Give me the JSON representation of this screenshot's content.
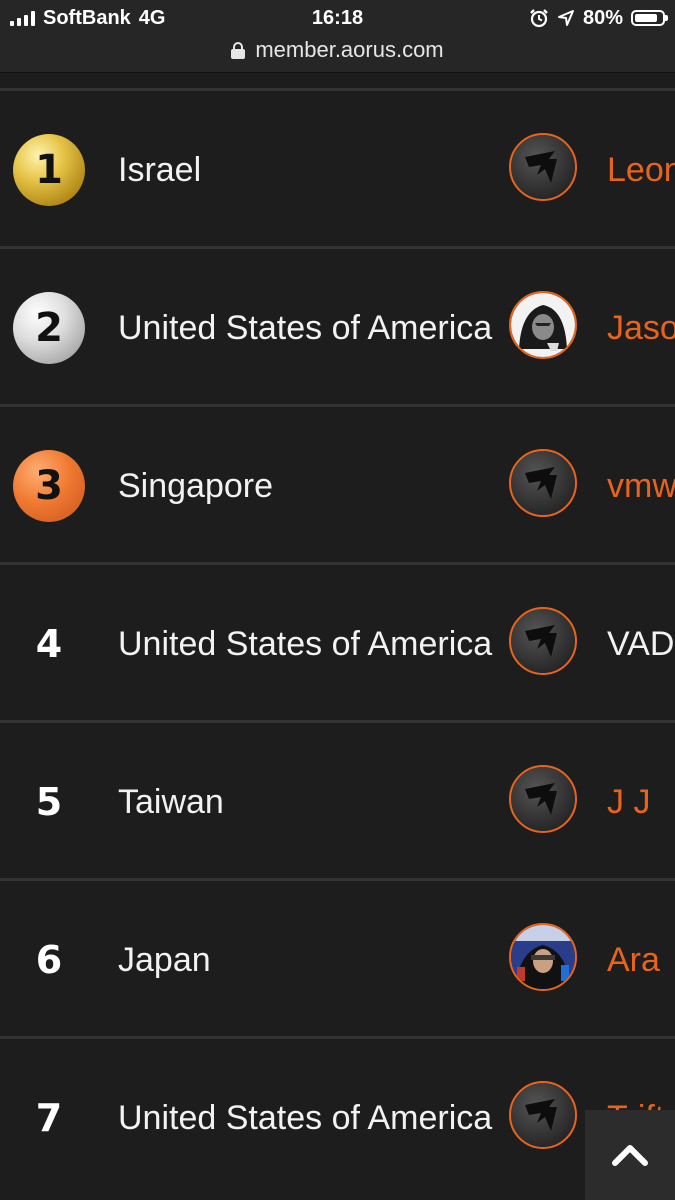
{
  "status_bar": {
    "carrier": "SoftBank",
    "network": "4G",
    "time": "16:18",
    "battery": "80%"
  },
  "browser": {
    "url": "member.aorus.com"
  },
  "colors": {
    "accent": "#e8641c",
    "background": "#1d1d1d"
  },
  "rankings": [
    {
      "rank": "1",
      "country": "Israel",
      "user": "Leon",
      "avatar": "aorus-logo-avatar",
      "medal": "gold"
    },
    {
      "rank": "2",
      "country": "United States of America",
      "user": "Jaso",
      "avatar": "hooded-person-avatar",
      "medal": "silver"
    },
    {
      "rank": "3",
      "country": "Singapore",
      "user": "vmw",
      "avatar": "aorus-logo-avatar",
      "medal": "bronze"
    },
    {
      "rank": "4",
      "country": "United States of America",
      "user": "VAD",
      "avatar": "aorus-logo-avatar",
      "medal": "none"
    },
    {
      "rank": "5",
      "country": "Taiwan",
      "user": "J J",
      "avatar": "aorus-logo-avatar",
      "medal": "none"
    },
    {
      "rank": "6",
      "country": "Japan",
      "user": "Ara",
      "avatar": "photo-avatar",
      "medal": "none"
    },
    {
      "rank": "7",
      "country": "United States of America",
      "user": "Trift",
      "avatar": "aorus-logo-avatar",
      "medal": "none"
    }
  ],
  "back_to_top_icon": "chevron-up-icon"
}
